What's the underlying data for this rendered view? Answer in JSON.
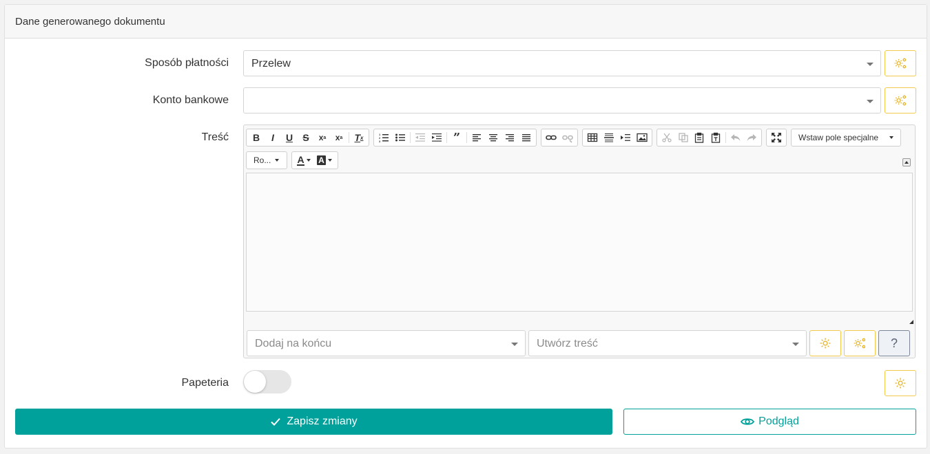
{
  "panel": {
    "title": "Dane generowanego dokumentu"
  },
  "payment": {
    "label": "Sposób płatności",
    "value": "Przelew"
  },
  "bank_account": {
    "label": "Konto bankowe",
    "value": ""
  },
  "content": {
    "label": "Treść",
    "toolbar": {
      "special_field": "Wstaw pole specjalne",
      "font": "Ro...",
      "text_color_letter": "A",
      "bg_color_letter": "A"
    },
    "append": {
      "placeholder": "Dodaj na końcu"
    },
    "create": {
      "placeholder": "Utwórz treść"
    },
    "help_symbol": "?"
  },
  "stationery": {
    "label": "Papeteria",
    "enabled": false
  },
  "actions": {
    "save_label": "Zapisz zmiany",
    "preview_label": "Podgląd"
  },
  "colors": {
    "accent": "#00a19a",
    "gear": "#e6b325",
    "border_gear": "#f2c94c"
  }
}
